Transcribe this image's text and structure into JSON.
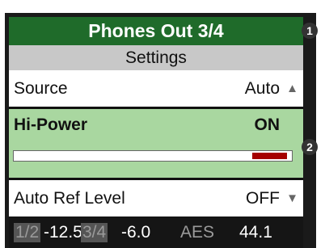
{
  "header": {
    "title": "Phones Out 3/4"
  },
  "subheader": {
    "title": "Settings"
  },
  "rows": {
    "source": {
      "label": "Source",
      "value": "Auto",
      "arrow": "▲"
    },
    "hi_power": {
      "label": "Hi-Power",
      "value": "ON",
      "meter_level": 0.13
    },
    "auto_ref_level": {
      "label": "Auto Ref Level",
      "value": "OFF",
      "arrow": "▼"
    }
  },
  "status": {
    "ch12_label": "1/2",
    "ch12_value": "-12.5",
    "ch34_label": "3/4",
    "ch34_value": "-6.0",
    "aes_label": "AES",
    "sample_rate": "44.1"
  },
  "callouts": {
    "one": "1",
    "two": "2"
  },
  "colors": {
    "title_bg": "#1f6b2a",
    "subtitle_bg": "#c8c8c8",
    "selected_bg": "#a9d7a0",
    "meter_fill": "#a50000",
    "status_bg": "#151515"
  }
}
